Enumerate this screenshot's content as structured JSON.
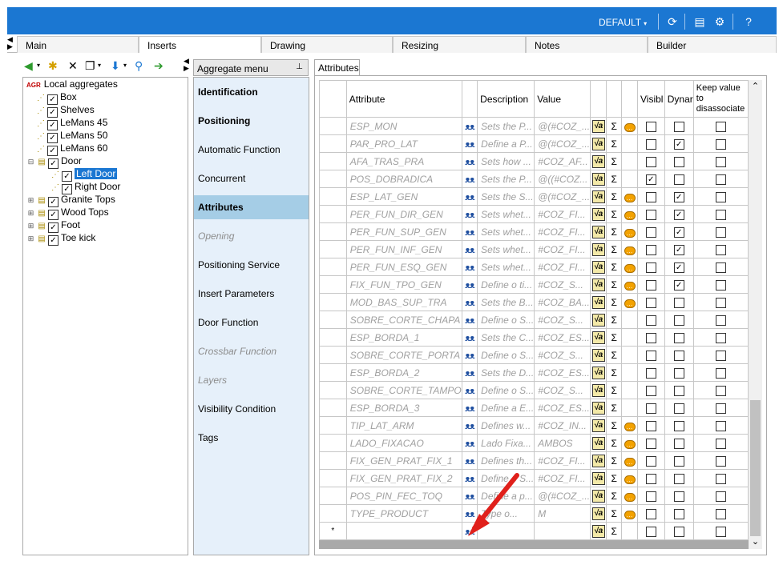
{
  "topbar": {
    "preset": "DEFAULT",
    "icons": [
      "refresh-icon",
      "catalog-icon",
      "settings-icon",
      "help-icon"
    ]
  },
  "tabs": [
    "Main",
    "Inserts",
    "Drawing",
    "Resizing",
    "Notes",
    "Builder"
  ],
  "active_tab": "Inserts",
  "tree": {
    "root": {
      "tag": "AGR",
      "label": "Local aggregates"
    },
    "items": [
      {
        "label": "Box",
        "checked": true
      },
      {
        "label": "Shelves",
        "checked": true
      },
      {
        "label": "LeMans 45",
        "checked": true
      },
      {
        "label": "LeMans 50",
        "checked": true
      },
      {
        "label": "LeMans 60",
        "checked": true
      },
      {
        "label": "Door",
        "checked": true
      },
      {
        "label": "Left Door",
        "checked": true,
        "selected": true
      },
      {
        "label": "Right Door",
        "checked": true
      },
      {
        "label": "Granite Tops",
        "checked": true
      },
      {
        "label": "Wood Tops",
        "checked": true
      },
      {
        "label": "Foot",
        "checked": true
      },
      {
        "label": "Toe kick",
        "checked": true
      }
    ]
  },
  "menu": {
    "title": "Aggregate menu",
    "items": [
      {
        "label": "Identification",
        "style": "bold"
      },
      {
        "label": "Positioning",
        "style": "bold"
      },
      {
        "label": "Automatic Function",
        "style": "normal"
      },
      {
        "label": "Concurrent",
        "style": "normal"
      },
      {
        "label": "Attributes",
        "style": "active"
      },
      {
        "label": "Opening",
        "style": "dim"
      },
      {
        "label": "Positioning Service",
        "style": "normal"
      },
      {
        "label": "Insert Parameters",
        "style": "normal"
      },
      {
        "label": "Door Function",
        "style": "normal"
      },
      {
        "label": "Crossbar Function",
        "style": "dim"
      },
      {
        "label": "Layers",
        "style": "dim"
      },
      {
        "label": "Visibility Condition",
        "style": "normal"
      },
      {
        "label": "Tags",
        "style": "normal"
      }
    ]
  },
  "attributes_tab": "Attributes",
  "columns": {
    "attribute": "Attribute",
    "description": "Description",
    "value": "Value",
    "visible": "Visibl",
    "dynamic": "Dynar",
    "keep": "Keep value to disassociate"
  },
  "rows": [
    {
      "attr": "ESP_MON",
      "desc": "Sets the P...",
      "value": "@(#COZ_...",
      "bubble": true,
      "vis": false,
      "dyn": false,
      "keep": false
    },
    {
      "attr": "PAR_PRO_LAT",
      "desc": "Define a P...",
      "value": "@(#COZ_...",
      "bubble": false,
      "vis": false,
      "dyn": true,
      "keep": false
    },
    {
      "attr": "AFA_TRAS_PRA",
      "desc": "Sets how ...",
      "value": "#COZ_AF...",
      "bubble": false,
      "vis": false,
      "dyn": false,
      "keep": false
    },
    {
      "attr": "POS_DOBRADICA",
      "desc": "Sets the P...",
      "value": "@((#COZ...",
      "bubble": false,
      "vis": true,
      "dyn": false,
      "keep": false
    },
    {
      "attr": "ESP_LAT_GEN",
      "desc": "Sets the S...",
      "value": "@(#COZ_...",
      "bubble": true,
      "vis": false,
      "dyn": true,
      "keep": false
    },
    {
      "attr": "PER_FUN_DIR_GEN",
      "desc": "Sets whet...",
      "value": "#COZ_FI...",
      "bubble": true,
      "vis": false,
      "dyn": true,
      "keep": false
    },
    {
      "attr": "PER_FUN_SUP_GEN",
      "desc": "Sets whet...",
      "value": "#COZ_FI...",
      "bubble": true,
      "vis": false,
      "dyn": true,
      "keep": false
    },
    {
      "attr": "PER_FUN_INF_GEN",
      "desc": "Sets whet...",
      "value": "#COZ_FI...",
      "bubble": true,
      "vis": false,
      "dyn": true,
      "keep": false
    },
    {
      "attr": "PER_FUN_ESQ_GEN",
      "desc": "Sets whet...",
      "value": "#COZ_FI...",
      "bubble": true,
      "vis": false,
      "dyn": true,
      "keep": false
    },
    {
      "attr": "FIX_FUN_TPO_GEN",
      "desc": "Define o ti...",
      "value": "#COZ_S...",
      "bubble": true,
      "vis": false,
      "dyn": true,
      "keep": false
    },
    {
      "attr": "MOD_BAS_SUP_TRA",
      "desc": "Sets the B...",
      "value": "#COZ_BA...",
      "bubble": true,
      "vis": false,
      "dyn": false,
      "keep": false
    },
    {
      "attr": "SOBRE_CORTE_CHAPA",
      "desc": "Define o S...",
      "value": "#COZ_S...",
      "bubble": false,
      "vis": false,
      "dyn": false,
      "keep": false
    },
    {
      "attr": "ESP_BORDA_1",
      "desc": "Sets the C...",
      "value": "#COZ_ES...",
      "bubble": false,
      "vis": false,
      "dyn": false,
      "keep": false
    },
    {
      "attr": "SOBRE_CORTE_PORTA",
      "desc": "Define o S...",
      "value": "#COZ_S...",
      "bubble": false,
      "vis": false,
      "dyn": false,
      "keep": false
    },
    {
      "attr": "ESP_BORDA_2",
      "desc": "Sets the D...",
      "value": "#COZ_ES...",
      "bubble": false,
      "vis": false,
      "dyn": false,
      "keep": false
    },
    {
      "attr": "SOBRE_CORTE_TAMPO",
      "desc": "Define o S...",
      "value": "#COZ_S...",
      "bubble": false,
      "vis": false,
      "dyn": false,
      "keep": false
    },
    {
      "attr": "ESP_BORDA_3",
      "desc": "Define a E...",
      "value": "#COZ_ES...",
      "bubble": false,
      "vis": false,
      "dyn": false,
      "keep": false
    },
    {
      "attr": "TIP_LAT_ARM",
      "desc": "Defines w...",
      "value": "#COZ_IN...",
      "bubble": true,
      "vis": false,
      "dyn": false,
      "keep": false
    },
    {
      "attr": "LADO_FIXACAO",
      "desc": "Lado Fixa...",
      "value": "AMBOS",
      "bubble": true,
      "vis": false,
      "dyn": false,
      "keep": false
    },
    {
      "attr": "FIX_GEN_PRAT_FIX_1",
      "desc": "Defines th...",
      "value": "#COZ_FI...",
      "bubble": true,
      "vis": false,
      "dyn": false,
      "keep": false
    },
    {
      "attr": "FIX_GEN_PRAT_FIX_2",
      "desc": "Define o S...",
      "value": "#COZ_FI...",
      "bubble": true,
      "vis": false,
      "dyn": false,
      "keep": false
    },
    {
      "attr": "POS_PIN_FEC_TOQ",
      "desc": "Define a p...",
      "value": "@(#COZ_...",
      "bubble": true,
      "vis": false,
      "dyn": false,
      "keep": false
    },
    {
      "attr": "TYPE_PRODUCT",
      "desc": "Type o...",
      "value": "M",
      "bubble": true,
      "vis": false,
      "dyn": false,
      "keep": false
    }
  ],
  "new_row_marker": "*",
  "colors": {
    "accent": "#1b77d2",
    "menu_bg": "#e6f0fa",
    "menu_active": "#a5cde6",
    "arrow": "#e0201b"
  }
}
